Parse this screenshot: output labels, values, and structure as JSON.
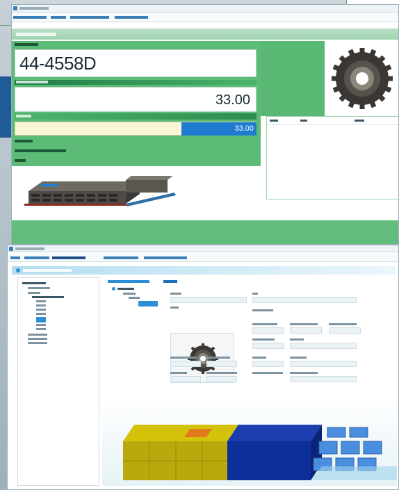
{
  "top_window": {
    "part_number": "44-4558D",
    "quantity_display": "33.00",
    "quantity_input": "33.00"
  }
}
